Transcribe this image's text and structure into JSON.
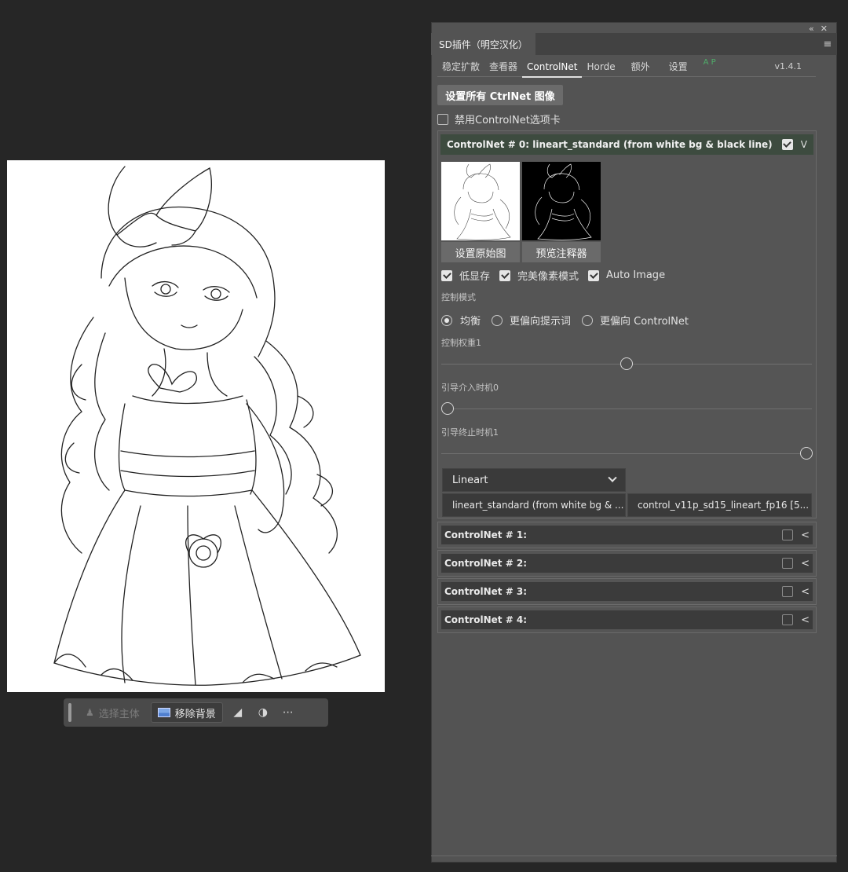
{
  "canvas": {
    "image_alt": ""
  },
  "taskbar": {
    "select_subject_label": "选择主体",
    "remove_bg_label": "移除背景"
  },
  "panel": {
    "title": "SD插件（明空汉化）",
    "tabs": [
      {
        "label": "稳定扩散"
      },
      {
        "label": "查看器"
      },
      {
        "label": "ControlNet"
      },
      {
        "label": "Horde"
      },
      {
        "label": "额外"
      },
      {
        "label": "设置"
      }
    ],
    "ap_badge": "A P",
    "version": "v1.4.1",
    "set_all_button": "设置所有 CtrlNet 图像",
    "disable_tab_label": "禁用ControlNet选项卡",
    "disable_tab_checked": false
  },
  "unit0": {
    "title": "ControlNet # 0: lineart_standard (from white bg & black line)",
    "enabled": true,
    "set_original_button": "设置原始图",
    "preview_annotator_button": "预览注释器",
    "options": [
      {
        "label": "低显存",
        "checked": true
      },
      {
        "label": "完美像素模式",
        "checked": true
      },
      {
        "label": "Auto Image",
        "checked": true
      }
    ],
    "control_mode_label": "控制模式",
    "control_modes": [
      {
        "label": "均衡",
        "selected": true
      },
      {
        "label": "更偏向提示词",
        "selected": false
      },
      {
        "label": "更偏向 ControlNet",
        "selected": false
      }
    ],
    "weight_label": "控制权重1",
    "weight_value": 1,
    "guidance_start_label": "引导介入时机0",
    "guidance_start_value": 0,
    "guidance_end_label": "引导终止时机1",
    "guidance_end_value": 1,
    "control_type": "Lineart",
    "preprocessor": "lineart_standard (from white bg & ...",
    "model": "control_v11p_sd15_lineart_fp16 [5..."
  },
  "collapsed_units": [
    {
      "title": "ControlNet # 1:",
      "enabled": false
    },
    {
      "title": "ControlNet # 2:",
      "enabled": false
    },
    {
      "title": "ControlNet # 3:",
      "enabled": false
    },
    {
      "title": "ControlNet # 4:",
      "enabled": false
    }
  ]
}
